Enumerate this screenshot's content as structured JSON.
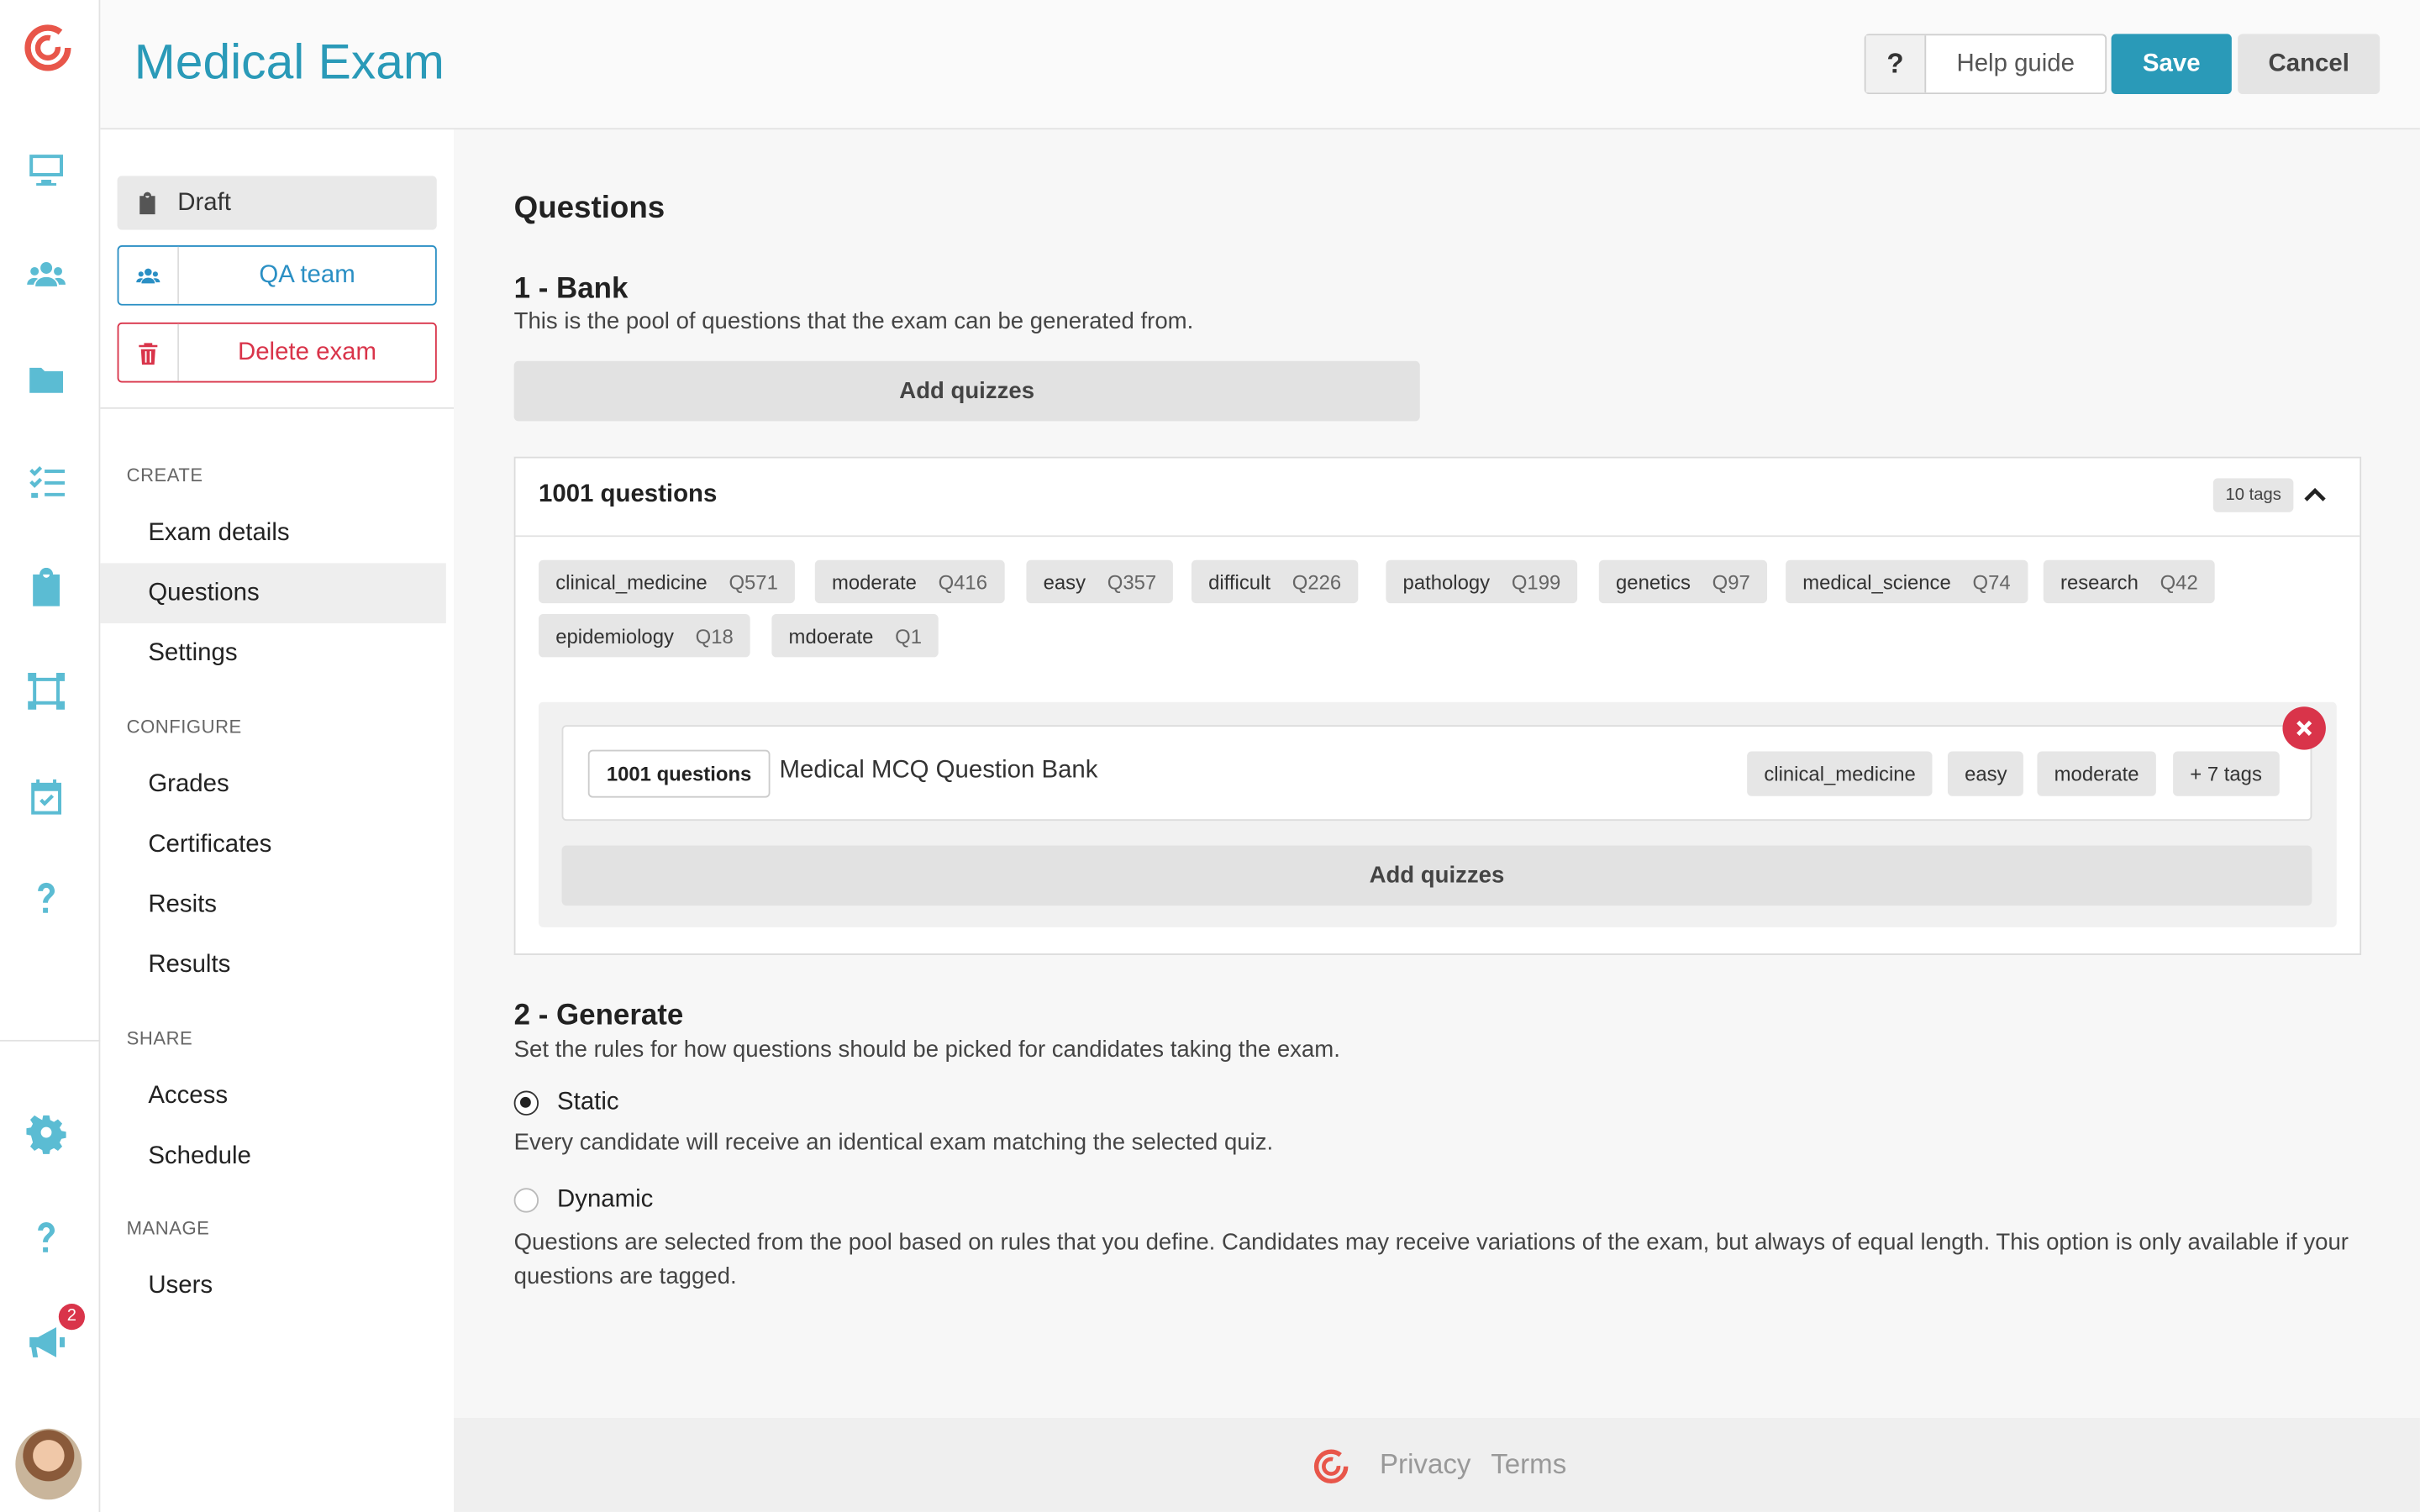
{
  "app": {
    "title": "Medical Exam",
    "notification_count": "2"
  },
  "header": {
    "help_icon": "?",
    "help_label": "Help guide",
    "save_label": "Save",
    "cancel_label": "Cancel"
  },
  "rail": {
    "icons": [
      "monitor-icon",
      "users-icon",
      "folder-icon",
      "checklist-icon",
      "clipboard-icon",
      "frame-icon",
      "calendar-check-icon",
      "help-icon",
      "gear-icon",
      "question-icon",
      "megaphone-icon"
    ]
  },
  "side": {
    "status": "Draft",
    "qa_team": "QA team",
    "delete_exam": "Delete exam",
    "sections": {
      "create": "CREATE",
      "configure": "CONFIGURE",
      "share": "SHARE",
      "manage": "MANAGE"
    },
    "nav": {
      "exam_details": "Exam details",
      "questions": "Questions",
      "settings": "Settings",
      "grades": "Grades",
      "certificates": "Certificates",
      "resits": "Resits",
      "results": "Results",
      "access": "Access",
      "schedule": "Schedule",
      "users": "Users"
    },
    "active": "Questions"
  },
  "main": {
    "heading": "Questions",
    "bank": {
      "title": "1 - Bank",
      "description": "This is the pool of questions that the exam can be generated from.",
      "add_quizzes": "Add quizzes",
      "count_title": "1001 questions",
      "tag_count": "10 tags",
      "tags": [
        {
          "name": "clinical_medicine",
          "count": "Q571"
        },
        {
          "name": "moderate",
          "count": "Q416"
        },
        {
          "name": "easy",
          "count": "Q357"
        },
        {
          "name": "difficult",
          "count": "Q226"
        },
        {
          "name": "pathology",
          "count": "Q199"
        },
        {
          "name": "genetics",
          "count": "Q97"
        },
        {
          "name": "medical_science",
          "count": "Q74"
        },
        {
          "name": "research",
          "count": "Q42"
        },
        {
          "name": "epidemiology",
          "count": "Q18"
        },
        {
          "name": "mdoerate",
          "count": "Q1"
        }
      ],
      "quiz": {
        "count": "1001 questions",
        "name": "Medical MCQ Question Bank",
        "tags": [
          "clinical_medicine",
          "easy",
          "moderate",
          "+ 7 tags"
        ]
      },
      "inner_add_quizzes": "Add quizzes"
    },
    "generate": {
      "title": "2 - Generate",
      "description": "Set the rules for how questions should be picked for candidates taking the exam.",
      "static_label": "Static",
      "static_desc": "Every candidate will receive an identical exam matching the selected quiz.",
      "dynamic_label": "Dynamic",
      "dynamic_desc": "Questions are selected from the pool based on rules that you define. Candidates may receive variations of the exam, but always of equal length. This option is only available if your questions are tagged.",
      "selected": "Static"
    }
  },
  "footer": {
    "privacy": "Privacy",
    "terms": "Terms"
  },
  "colors": {
    "accent": "#2a9ab8",
    "danger": "#d9344a",
    "link_blue": "#2a8fc4"
  }
}
